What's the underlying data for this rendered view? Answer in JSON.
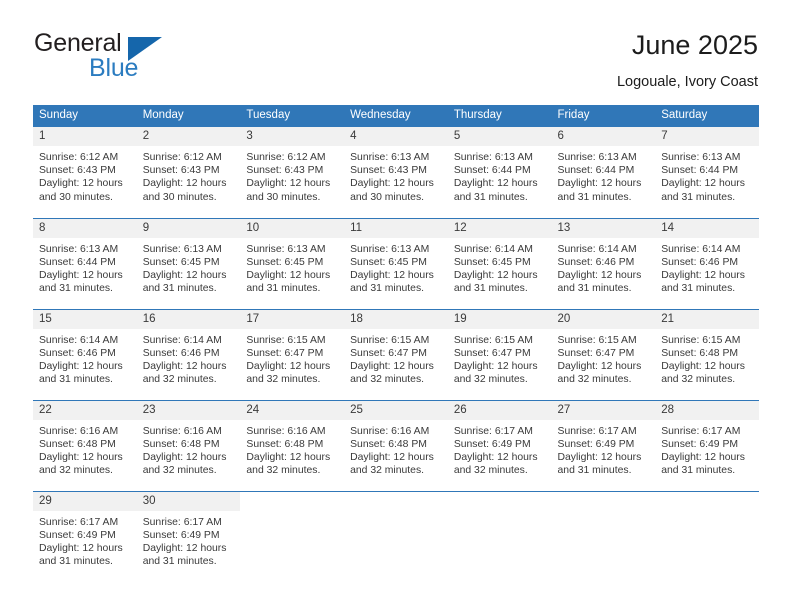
{
  "brand": {
    "line1": "General",
    "line2": "Blue",
    "flag_icon": "triangle-flag-icon"
  },
  "header": {
    "title": "June 2025",
    "subtitle": "Logouale, Ivory Coast"
  },
  "calendar": {
    "accent_color": "#3077b8",
    "daynum_bg": "#f1f1f1",
    "weekday_headers": [
      "Sunday",
      "Monday",
      "Tuesday",
      "Wednesday",
      "Thursday",
      "Friday",
      "Saturday"
    ],
    "weeks": [
      [
        {
          "day": "1",
          "sunrise": "Sunrise: 6:12 AM",
          "sunset": "Sunset: 6:43 PM",
          "daylight1": "Daylight: 12 hours",
          "daylight2": "and 30 minutes."
        },
        {
          "day": "2",
          "sunrise": "Sunrise: 6:12 AM",
          "sunset": "Sunset: 6:43 PM",
          "daylight1": "Daylight: 12 hours",
          "daylight2": "and 30 minutes."
        },
        {
          "day": "3",
          "sunrise": "Sunrise: 6:12 AM",
          "sunset": "Sunset: 6:43 PM",
          "daylight1": "Daylight: 12 hours",
          "daylight2": "and 30 minutes."
        },
        {
          "day": "4",
          "sunrise": "Sunrise: 6:13 AM",
          "sunset": "Sunset: 6:43 PM",
          "daylight1": "Daylight: 12 hours",
          "daylight2": "and 30 minutes."
        },
        {
          "day": "5",
          "sunrise": "Sunrise: 6:13 AM",
          "sunset": "Sunset: 6:44 PM",
          "daylight1": "Daylight: 12 hours",
          "daylight2": "and 31 minutes."
        },
        {
          "day": "6",
          "sunrise": "Sunrise: 6:13 AM",
          "sunset": "Sunset: 6:44 PM",
          "daylight1": "Daylight: 12 hours",
          "daylight2": "and 31 minutes."
        },
        {
          "day": "7",
          "sunrise": "Sunrise: 6:13 AM",
          "sunset": "Sunset: 6:44 PM",
          "daylight1": "Daylight: 12 hours",
          "daylight2": "and 31 minutes."
        }
      ],
      [
        {
          "day": "8",
          "sunrise": "Sunrise: 6:13 AM",
          "sunset": "Sunset: 6:44 PM",
          "daylight1": "Daylight: 12 hours",
          "daylight2": "and 31 minutes."
        },
        {
          "day": "9",
          "sunrise": "Sunrise: 6:13 AM",
          "sunset": "Sunset: 6:45 PM",
          "daylight1": "Daylight: 12 hours",
          "daylight2": "and 31 minutes."
        },
        {
          "day": "10",
          "sunrise": "Sunrise: 6:13 AM",
          "sunset": "Sunset: 6:45 PM",
          "daylight1": "Daylight: 12 hours",
          "daylight2": "and 31 minutes."
        },
        {
          "day": "11",
          "sunrise": "Sunrise: 6:13 AM",
          "sunset": "Sunset: 6:45 PM",
          "daylight1": "Daylight: 12 hours",
          "daylight2": "and 31 minutes."
        },
        {
          "day": "12",
          "sunrise": "Sunrise: 6:14 AM",
          "sunset": "Sunset: 6:45 PM",
          "daylight1": "Daylight: 12 hours",
          "daylight2": "and 31 minutes."
        },
        {
          "day": "13",
          "sunrise": "Sunrise: 6:14 AM",
          "sunset": "Sunset: 6:46 PM",
          "daylight1": "Daylight: 12 hours",
          "daylight2": "and 31 minutes."
        },
        {
          "day": "14",
          "sunrise": "Sunrise: 6:14 AM",
          "sunset": "Sunset: 6:46 PM",
          "daylight1": "Daylight: 12 hours",
          "daylight2": "and 31 minutes."
        }
      ],
      [
        {
          "day": "15",
          "sunrise": "Sunrise: 6:14 AM",
          "sunset": "Sunset: 6:46 PM",
          "daylight1": "Daylight: 12 hours",
          "daylight2": "and 31 minutes."
        },
        {
          "day": "16",
          "sunrise": "Sunrise: 6:14 AM",
          "sunset": "Sunset: 6:46 PM",
          "daylight1": "Daylight: 12 hours",
          "daylight2": "and 32 minutes."
        },
        {
          "day": "17",
          "sunrise": "Sunrise: 6:15 AM",
          "sunset": "Sunset: 6:47 PM",
          "daylight1": "Daylight: 12 hours",
          "daylight2": "and 32 minutes."
        },
        {
          "day": "18",
          "sunrise": "Sunrise: 6:15 AM",
          "sunset": "Sunset: 6:47 PM",
          "daylight1": "Daylight: 12 hours",
          "daylight2": "and 32 minutes."
        },
        {
          "day": "19",
          "sunrise": "Sunrise: 6:15 AM",
          "sunset": "Sunset: 6:47 PM",
          "daylight1": "Daylight: 12 hours",
          "daylight2": "and 32 minutes."
        },
        {
          "day": "20",
          "sunrise": "Sunrise: 6:15 AM",
          "sunset": "Sunset: 6:47 PM",
          "daylight1": "Daylight: 12 hours",
          "daylight2": "and 32 minutes."
        },
        {
          "day": "21",
          "sunrise": "Sunrise: 6:15 AM",
          "sunset": "Sunset: 6:48 PM",
          "daylight1": "Daylight: 12 hours",
          "daylight2": "and 32 minutes."
        }
      ],
      [
        {
          "day": "22",
          "sunrise": "Sunrise: 6:16 AM",
          "sunset": "Sunset: 6:48 PM",
          "daylight1": "Daylight: 12 hours",
          "daylight2": "and 32 minutes."
        },
        {
          "day": "23",
          "sunrise": "Sunrise: 6:16 AM",
          "sunset": "Sunset: 6:48 PM",
          "daylight1": "Daylight: 12 hours",
          "daylight2": "and 32 minutes."
        },
        {
          "day": "24",
          "sunrise": "Sunrise: 6:16 AM",
          "sunset": "Sunset: 6:48 PM",
          "daylight1": "Daylight: 12 hours",
          "daylight2": "and 32 minutes."
        },
        {
          "day": "25",
          "sunrise": "Sunrise: 6:16 AM",
          "sunset": "Sunset: 6:48 PM",
          "daylight1": "Daylight: 12 hours",
          "daylight2": "and 32 minutes."
        },
        {
          "day": "26",
          "sunrise": "Sunrise: 6:17 AM",
          "sunset": "Sunset: 6:49 PM",
          "daylight1": "Daylight: 12 hours",
          "daylight2": "and 32 minutes."
        },
        {
          "day": "27",
          "sunrise": "Sunrise: 6:17 AM",
          "sunset": "Sunset: 6:49 PM",
          "daylight1": "Daylight: 12 hours",
          "daylight2": "and 31 minutes."
        },
        {
          "day": "28",
          "sunrise": "Sunrise: 6:17 AM",
          "sunset": "Sunset: 6:49 PM",
          "daylight1": "Daylight: 12 hours",
          "daylight2": "and 31 minutes."
        }
      ],
      [
        {
          "day": "29",
          "sunrise": "Sunrise: 6:17 AM",
          "sunset": "Sunset: 6:49 PM",
          "daylight1": "Daylight: 12 hours",
          "daylight2": "and 31 minutes."
        },
        {
          "day": "30",
          "sunrise": "Sunrise: 6:17 AM",
          "sunset": "Sunset: 6:49 PM",
          "daylight1": "Daylight: 12 hours",
          "daylight2": "and 31 minutes."
        },
        {
          "day": "",
          "sunrise": "",
          "sunset": "",
          "daylight1": "",
          "daylight2": ""
        },
        {
          "day": "",
          "sunrise": "",
          "sunset": "",
          "daylight1": "",
          "daylight2": ""
        },
        {
          "day": "",
          "sunrise": "",
          "sunset": "",
          "daylight1": "",
          "daylight2": ""
        },
        {
          "day": "",
          "sunrise": "",
          "sunset": "",
          "daylight1": "",
          "daylight2": ""
        },
        {
          "day": "",
          "sunrise": "",
          "sunset": "",
          "daylight1": "",
          "daylight2": ""
        }
      ]
    ]
  }
}
